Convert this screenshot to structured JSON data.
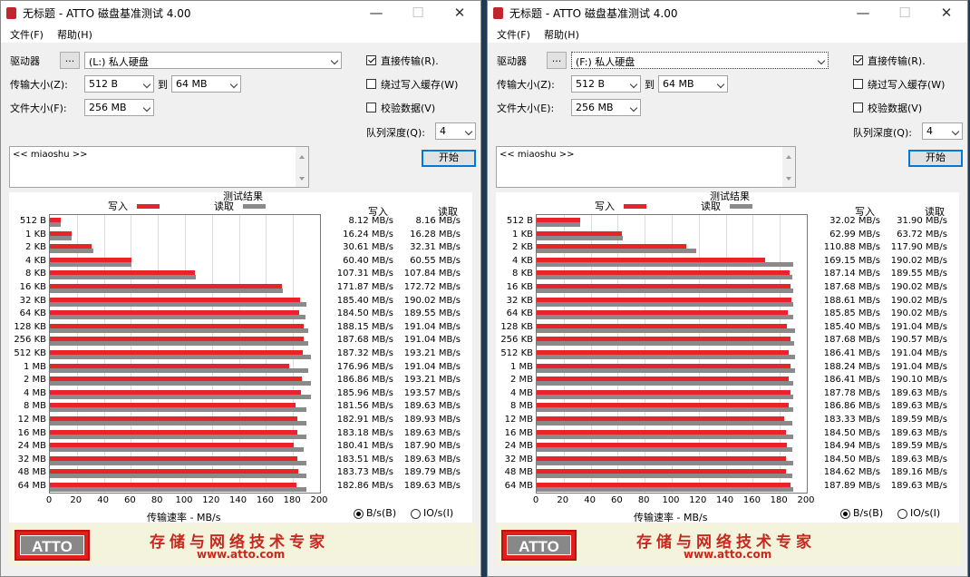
{
  "windows": [
    {
      "title": "无标题 - ATTO 磁盘基准测试 4.00",
      "menu": [
        "文件(F)",
        "帮助(H)"
      ],
      "drive_label": "驱动器",
      "browse_label": "...",
      "drive_value": "(L:) 私人硬盘",
      "transfer_label": "传输大小(Z):",
      "transfer_from": "512 B",
      "to_label": "到",
      "transfer_to": "64 MB",
      "filesize_label": "文件大小(F):",
      "filesize": "256 MB",
      "direct_io": "直接传输(R).",
      "bypass_cache": "绕过写入缓存(W)",
      "verify": "校验数据(V)",
      "queue_label": "队列深度(Q):",
      "queue_value": "4",
      "description": "<< miaoshu >>",
      "start_label": "开始",
      "results_title": "测试结果",
      "legend_write": "写入",
      "legend_read": "读取",
      "col_write": "写入",
      "col_read": "读取",
      "x_axis_label": "传输速率 - MB/s",
      "radio_bytes": "B/s(B)",
      "radio_io": "IO/s(I)",
      "banner_logo": "ATTO",
      "banner_slogan": "存储与网络技术专家",
      "banner_url": "www.atto.com",
      "chart_data": {
        "type": "bar",
        "categories": [
          "512 B",
          "1 KB",
          "2 KB",
          "4 KB",
          "8 KB",
          "16 KB",
          "32 KB",
          "64 KB",
          "128 KB",
          "256 KB",
          "512 KB",
          "1 MB",
          "2 MB",
          "4 MB",
          "8 MB",
          "12 MB",
          "16 MB",
          "24 MB",
          "32 MB",
          "48 MB",
          "64 MB"
        ],
        "xlim": [
          0,
          200
        ],
        "xticks": [
          0,
          20,
          40,
          60,
          80,
          100,
          120,
          140,
          160,
          180,
          200
        ],
        "series": [
          {
            "name": "写入",
            "color": "#e8232a",
            "values": [
              8.12,
              16.24,
              30.61,
              60.4,
              107.31,
              171.87,
              185.4,
              184.5,
              188.15,
              187.68,
              187.32,
              176.96,
              186.86,
              185.96,
              181.56,
              182.91,
              183.18,
              180.41,
              183.51,
              183.73,
              182.86
            ]
          },
          {
            "name": "读取",
            "color": "#8a8a8a",
            "values": [
              8.16,
              16.28,
              32.31,
              60.55,
              107.84,
              172.72,
              190.02,
              189.55,
              191.04,
              191.04,
              193.21,
              191.04,
              193.21,
              193.57,
              189.63,
              189.93,
              189.63,
              187.9,
              189.63,
              189.79,
              189.63
            ]
          }
        ],
        "write_text": [
          "8.12 MB/s",
          "16.24 MB/s",
          "30.61 MB/s",
          "60.40 MB/s",
          "107.31 MB/s",
          "171.87 MB/s",
          "185.40 MB/s",
          "184.50 MB/s",
          "188.15 MB/s",
          "187.68 MB/s",
          "187.32 MB/s",
          "176.96 MB/s",
          "186.86 MB/s",
          "185.96 MB/s",
          "181.56 MB/s",
          "182.91 MB/s",
          "183.18 MB/s",
          "180.41 MB/s",
          "183.51 MB/s",
          "183.73 MB/s",
          "182.86 MB/s"
        ],
        "read_text": [
          "8.16 MB/s",
          "16.28 MB/s",
          "32.31 MB/s",
          "60.55 MB/s",
          "107.84 MB/s",
          "172.72 MB/s",
          "190.02 MB/s",
          "189.55 MB/s",
          "191.04 MB/s",
          "191.04 MB/s",
          "193.21 MB/s",
          "191.04 MB/s",
          "193.21 MB/s",
          "193.57 MB/s",
          "189.63 MB/s",
          "189.93 MB/s",
          "189.63 MB/s",
          "187.90 MB/s",
          "189.63 MB/s",
          "189.79 MB/s",
          "189.63 MB/s"
        ]
      }
    },
    {
      "title": "无标题 - ATTO 磁盘基准测试 4.00",
      "menu": [
        "文件(F)",
        "帮助(H)"
      ],
      "drive_label": "驱动器",
      "browse_label": "...",
      "drive_value": "(F:) 私人硬盘",
      "transfer_label": "传输大小(Z):",
      "transfer_from": "512 B",
      "to_label": "到",
      "transfer_to": "64 MB",
      "filesize_label": "文件大小(E):",
      "filesize": "256 MB",
      "direct_io": "直接传输(R).",
      "bypass_cache": "绕过写入缓存(W)",
      "verify": "校验数据(V)",
      "queue_label": "队列深度(Q):",
      "queue_value": "4",
      "description": "<< miaoshu >>",
      "start_label": "开始",
      "results_title": "测试结果",
      "legend_write": "写入",
      "legend_read": "读取",
      "col_write": "写入",
      "col_read": "读取",
      "x_axis_label": "传输速率 - MB/s",
      "radio_bytes": "B/s(B)",
      "radio_io": "IO/s(I)",
      "banner_logo": "ATTO",
      "banner_slogan": "存储与网络技术专家",
      "banner_url": "www.atto.com",
      "chart_data": {
        "type": "bar",
        "categories": [
          "512 B",
          "1 KB",
          "2 KB",
          "4 KB",
          "8 KB",
          "16 KB",
          "32 KB",
          "64 KB",
          "128 KB",
          "256 KB",
          "512 KB",
          "1 MB",
          "2 MB",
          "4 MB",
          "8 MB",
          "12 MB",
          "16 MB",
          "24 MB",
          "32 MB",
          "48 MB",
          "64 MB"
        ],
        "xlim": [
          0,
          200
        ],
        "xticks": [
          0,
          20,
          40,
          60,
          80,
          100,
          120,
          140,
          160,
          180,
          200
        ],
        "series": [
          {
            "name": "写入",
            "color": "#e8232a",
            "values": [
              32.02,
              62.99,
              110.88,
              169.15,
              187.14,
              187.68,
              188.61,
              185.85,
              185.4,
              187.68,
              186.41,
              188.24,
              186.41,
              187.78,
              186.86,
              183.33,
              184.5,
              184.94,
              184.5,
              184.62,
              187.89
            ]
          },
          {
            "name": "读取",
            "color": "#8a8a8a",
            "values": [
              31.9,
              63.72,
              117.9,
              190.02,
              189.55,
              190.02,
              190.02,
              190.02,
              191.04,
              190.57,
              191.04,
              191.04,
              190.1,
              189.63,
              189.63,
              189.59,
              189.63,
              189.59,
              189.63,
              189.16,
              189.63
            ]
          }
        ],
        "write_text": [
          "32.02 MB/s",
          "62.99 MB/s",
          "110.88 MB/s",
          "169.15 MB/s",
          "187.14 MB/s",
          "187.68 MB/s",
          "188.61 MB/s",
          "185.85 MB/s",
          "185.40 MB/s",
          "187.68 MB/s",
          "186.41 MB/s",
          "188.24 MB/s",
          "186.41 MB/s",
          "187.78 MB/s",
          "186.86 MB/s",
          "183.33 MB/s",
          "184.50 MB/s",
          "184.94 MB/s",
          "184.50 MB/s",
          "184.62 MB/s",
          "187.89 MB/s"
        ],
        "read_text": [
          "31.90 MB/s",
          "63.72 MB/s",
          "117.90 MB/s",
          "190.02 MB/s",
          "189.55 MB/s",
          "190.02 MB/s",
          "190.02 MB/s",
          "190.02 MB/s",
          "191.04 MB/s",
          "190.57 MB/s",
          "191.04 MB/s",
          "191.04 MB/s",
          "190.10 MB/s",
          "189.63 MB/s",
          "189.63 MB/s",
          "189.59 MB/s",
          "189.63 MB/s",
          "189.59 MB/s",
          "189.63 MB/s",
          "189.16 MB/s",
          "189.63 MB/s"
        ]
      }
    }
  ]
}
